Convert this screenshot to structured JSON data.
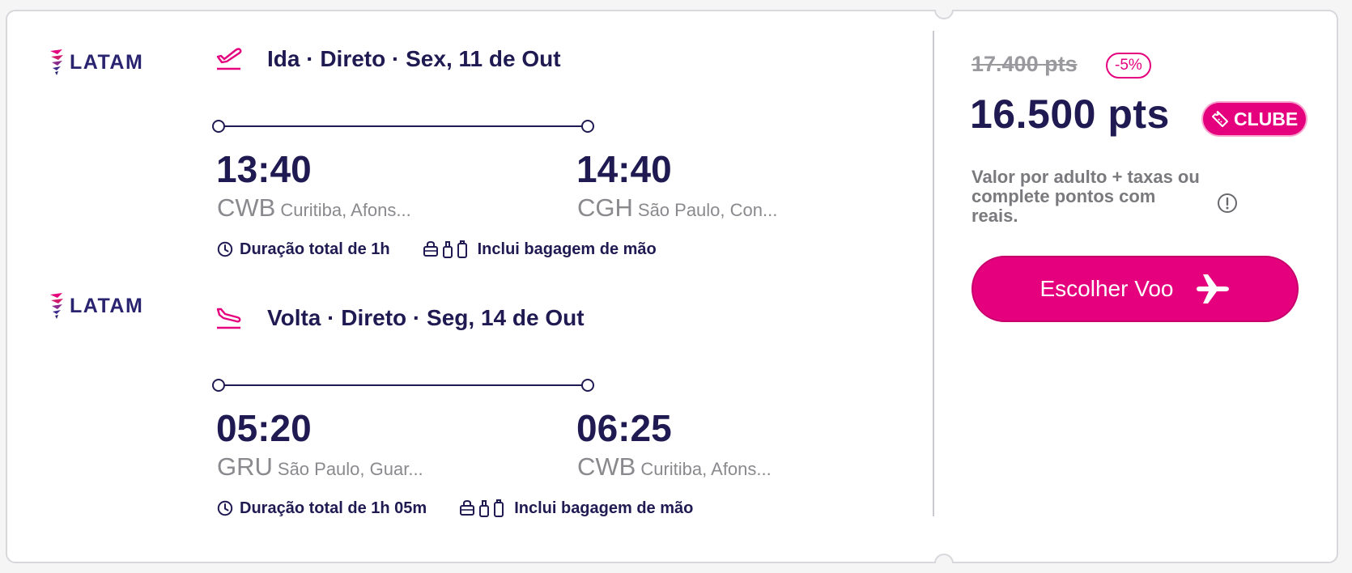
{
  "segments": [
    {
      "airline": "LATAM",
      "title": "Ida · Direto · Sex, 11 de Out",
      "direction_icon": "takeoff-icon",
      "departure": {
        "time": "13:40",
        "code": "CWB",
        "city": "Curitiba, Afons..."
      },
      "arrival": {
        "time": "14:40",
        "code": "CGH",
        "city": "São Paulo, Con..."
      },
      "duration": "Duração total de 1h",
      "baggage": "Inclui bagagem de mão"
    },
    {
      "airline": "LATAM",
      "title": "Volta · Direto · Seg, 14 de Out",
      "direction_icon": "landing-icon",
      "departure": {
        "time": "05:20",
        "code": "GRU",
        "city": "São Paulo, Guar..."
      },
      "arrival": {
        "time": "06:25",
        "code": "CWB",
        "city": "Curitiba, Afons..."
      },
      "duration": "Duração total de 1h 05m",
      "baggage": "Inclui bagagem de mão"
    }
  ],
  "pricing": {
    "old_price": "17.400 pts",
    "discount": "-5%",
    "price": "16.500 pts",
    "badge": "CLUBE",
    "note": "Valor por adulto + taxas ou complete pontos com reais.",
    "cta_label": "Escolher Voo"
  },
  "colors": {
    "accent": "#e5007d",
    "text_dark": "#1f1a52",
    "muted": "#8a8a8e"
  }
}
